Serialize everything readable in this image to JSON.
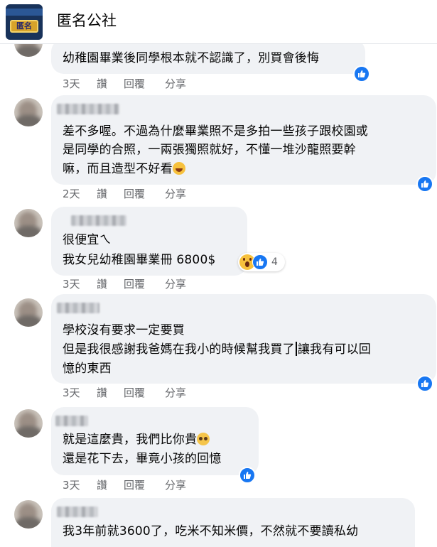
{
  "header": {
    "group_name": "匿名公社",
    "avatar_text": "匿名"
  },
  "colors": {
    "bubble_bg": "#f0f2f5",
    "like_blue": "#1877f2",
    "meta_gray": "#65676b"
  },
  "comments": [
    {
      "lines": [
        "幼稚園畢業後同學根本就不認識了，別買會後悔"
      ],
      "time": "3天",
      "read": "讚",
      "reply": "回覆",
      "share": "分享"
    },
    {
      "lines": [
        "差不多喔。不過為什麼畢業照不是多拍一些孩子跟校園或",
        "是同學的合照，一兩張獨照就好，不懂一堆沙龍照要幹",
        "嘛，而且造型不好看"
      ],
      "emoji": "rolling-laugh-emoji",
      "time": "2天",
      "read": "讚",
      "reply": "回覆",
      "share": "分享"
    },
    {
      "lines": [
        "很便宜ㄟ",
        "我女兒幼稚園畢業冊 6800$"
      ],
      "reaction_count": "4",
      "time": "3天",
      "read": "讚",
      "reply": "回覆",
      "share": "分享"
    },
    {
      "lines": [
        "學校沒有要求一定要買",
        "但是我很感謝我爸媽在我小的時候幫我買了",
        "讓我有可以回",
        "憶的東西"
      ],
      "time": "3天",
      "read": "讚",
      "reply": "回覆",
      "share": "分享"
    },
    {
      "lines": [
        "就是這麼貴，我們比你貴",
        "還是花下去，畢竟小孩的回憶"
      ],
      "emoji": "pleading-face-emoji",
      "time": "3天",
      "read": "讚",
      "reply": "回覆",
      "share": "分享"
    },
    {
      "lines": [
        "我3年前就3600了，吃米不知米價，不然就不要讀私幼"
      ]
    }
  ]
}
